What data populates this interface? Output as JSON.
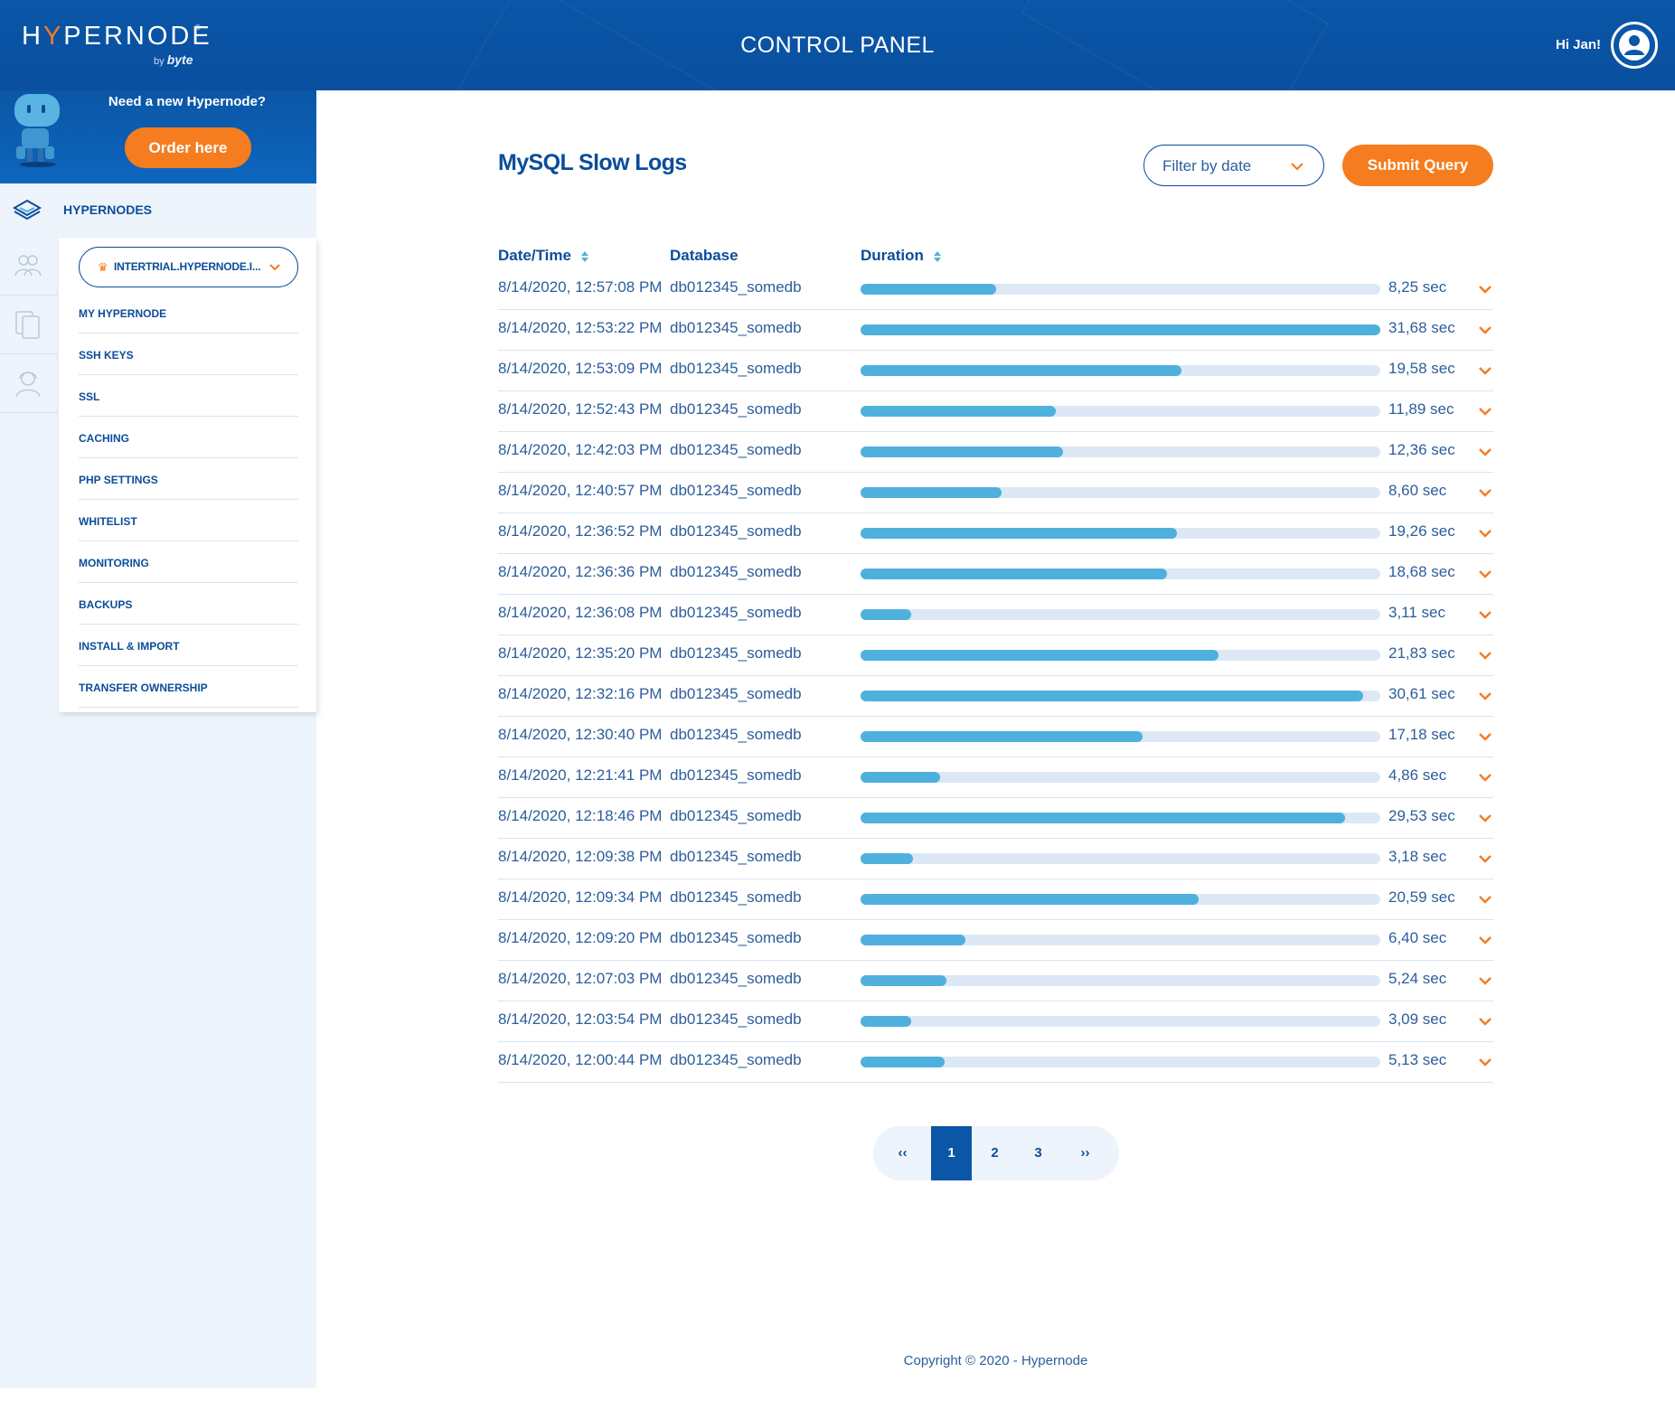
{
  "brand": {
    "name_pre": "H",
    "name_y": "Y",
    "name_post": "PERNODE",
    "reg": "®",
    "by": "by",
    "by_brand": "byte"
  },
  "header": {
    "title": "CONTROL PANEL",
    "greeting": "Hi Jan!"
  },
  "promo": {
    "title": "Need a new Hypernode?",
    "button": "Order here"
  },
  "sidebar": {
    "section_label": "HYPERNODES",
    "node_name": "INTERTRIAL.HYPERNODE.I...",
    "items": [
      "MY HYPERNODE",
      "SSH KEYS",
      "SSL",
      "CACHING",
      "PHP SETTINGS",
      "WHITELIST",
      "MONITORING",
      "BACKUPS",
      "INSTALL & IMPORT",
      "TRANSFER OWNERSHIP"
    ]
  },
  "main": {
    "title": "MySQL Slow Logs",
    "filter_placeholder": "Filter by date",
    "submit_label": "Submit Query",
    "columns": {
      "datetime": "Date/Time",
      "database": "Database",
      "duration": "Duration"
    },
    "max_duration": 31.68,
    "rows": [
      {
        "datetime": "8/14/2020, 12:57:08 PM",
        "database": "db012345_somedb",
        "duration": "8,25 sec",
        "seconds": 8.25
      },
      {
        "datetime": "8/14/2020, 12:53:22 PM",
        "database": "db012345_somedb",
        "duration": "31,68 sec",
        "seconds": 31.68
      },
      {
        "datetime": "8/14/2020, 12:53:09 PM",
        "database": "db012345_somedb",
        "duration": "19,58 sec",
        "seconds": 19.58
      },
      {
        "datetime": "8/14/2020, 12:52:43 PM",
        "database": "db012345_somedb",
        "duration": "11,89 sec",
        "seconds": 11.89
      },
      {
        "datetime": "8/14/2020, 12:42:03 PM",
        "database": "db012345_somedb",
        "duration": "12,36 sec",
        "seconds": 12.36
      },
      {
        "datetime": "8/14/2020, 12:40:57 PM",
        "database": "db012345_somedb",
        "duration": "8,60 sec",
        "seconds": 8.6
      },
      {
        "datetime": "8/14/2020, 12:36:52 PM",
        "database": "db012345_somedb",
        "duration": "19,26 sec",
        "seconds": 19.26
      },
      {
        "datetime": "8/14/2020, 12:36:36 PM",
        "database": "db012345_somedb",
        "duration": "18,68 sec",
        "seconds": 18.68
      },
      {
        "datetime": "8/14/2020, 12:36:08 PM",
        "database": "db012345_somedb",
        "duration": "3,11 sec",
        "seconds": 3.11
      },
      {
        "datetime": "8/14/2020, 12:35:20 PM",
        "database": "db012345_somedb",
        "duration": "21,83 sec",
        "seconds": 21.83
      },
      {
        "datetime": "8/14/2020, 12:32:16 PM",
        "database": "db012345_somedb",
        "duration": "30,61 sec",
        "seconds": 30.61
      },
      {
        "datetime": "8/14/2020, 12:30:40 PM",
        "database": "db012345_somedb",
        "duration": "17,18 sec",
        "seconds": 17.18
      },
      {
        "datetime": "8/14/2020, 12:21:41 PM",
        "database": "db012345_somedb",
        "duration": "4,86 sec",
        "seconds": 4.86
      },
      {
        "datetime": "8/14/2020, 12:18:46 PM",
        "database": "db012345_somedb",
        "duration": "29,53 sec",
        "seconds": 29.53
      },
      {
        "datetime": "8/14/2020, 12:09:38 PM",
        "database": "db012345_somedb",
        "duration": "3,18 sec",
        "seconds": 3.18
      },
      {
        "datetime": "8/14/2020, 12:09:34 PM",
        "database": "db012345_somedb",
        "duration": "20,59 sec",
        "seconds": 20.59
      },
      {
        "datetime": "8/14/2020, 12:09:20 PM",
        "database": "db012345_somedb",
        "duration": "6,40 sec",
        "seconds": 6.4
      },
      {
        "datetime": "8/14/2020, 12:07:03 PM",
        "database": "db012345_somedb",
        "duration": "5,24 sec",
        "seconds": 5.24
      },
      {
        "datetime": "8/14/2020, 12:03:54 PM",
        "database": "db012345_somedb",
        "duration": "3,09 sec",
        "seconds": 3.09
      },
      {
        "datetime": "8/14/2020, 12:00:44 PM",
        "database": "db012345_somedb",
        "duration": "5,13 sec",
        "seconds": 5.13
      }
    ]
  },
  "pagination": {
    "first": "‹‹",
    "pages": [
      "1",
      "2",
      "3"
    ],
    "active": "1",
    "last": "››"
  },
  "footer": {
    "copyright": "Copyright © 2020 - Hypernode"
  },
  "colors": {
    "brand_blue": "#0b56a6",
    "accent_orange": "#f57c1f",
    "bar_fill": "#4fb0de",
    "bar_track": "#dce8f4",
    "sidebar_bg": "#eef4fb"
  },
  "icons": {
    "avatar": "user-circle-icon",
    "hypernodes": "layers-icon",
    "users": "users-icon",
    "documents": "documents-icon",
    "support": "support-agent-icon",
    "crown": "crown-icon",
    "row_expand": "chevron-down-icon",
    "sort": "sort-icon"
  }
}
